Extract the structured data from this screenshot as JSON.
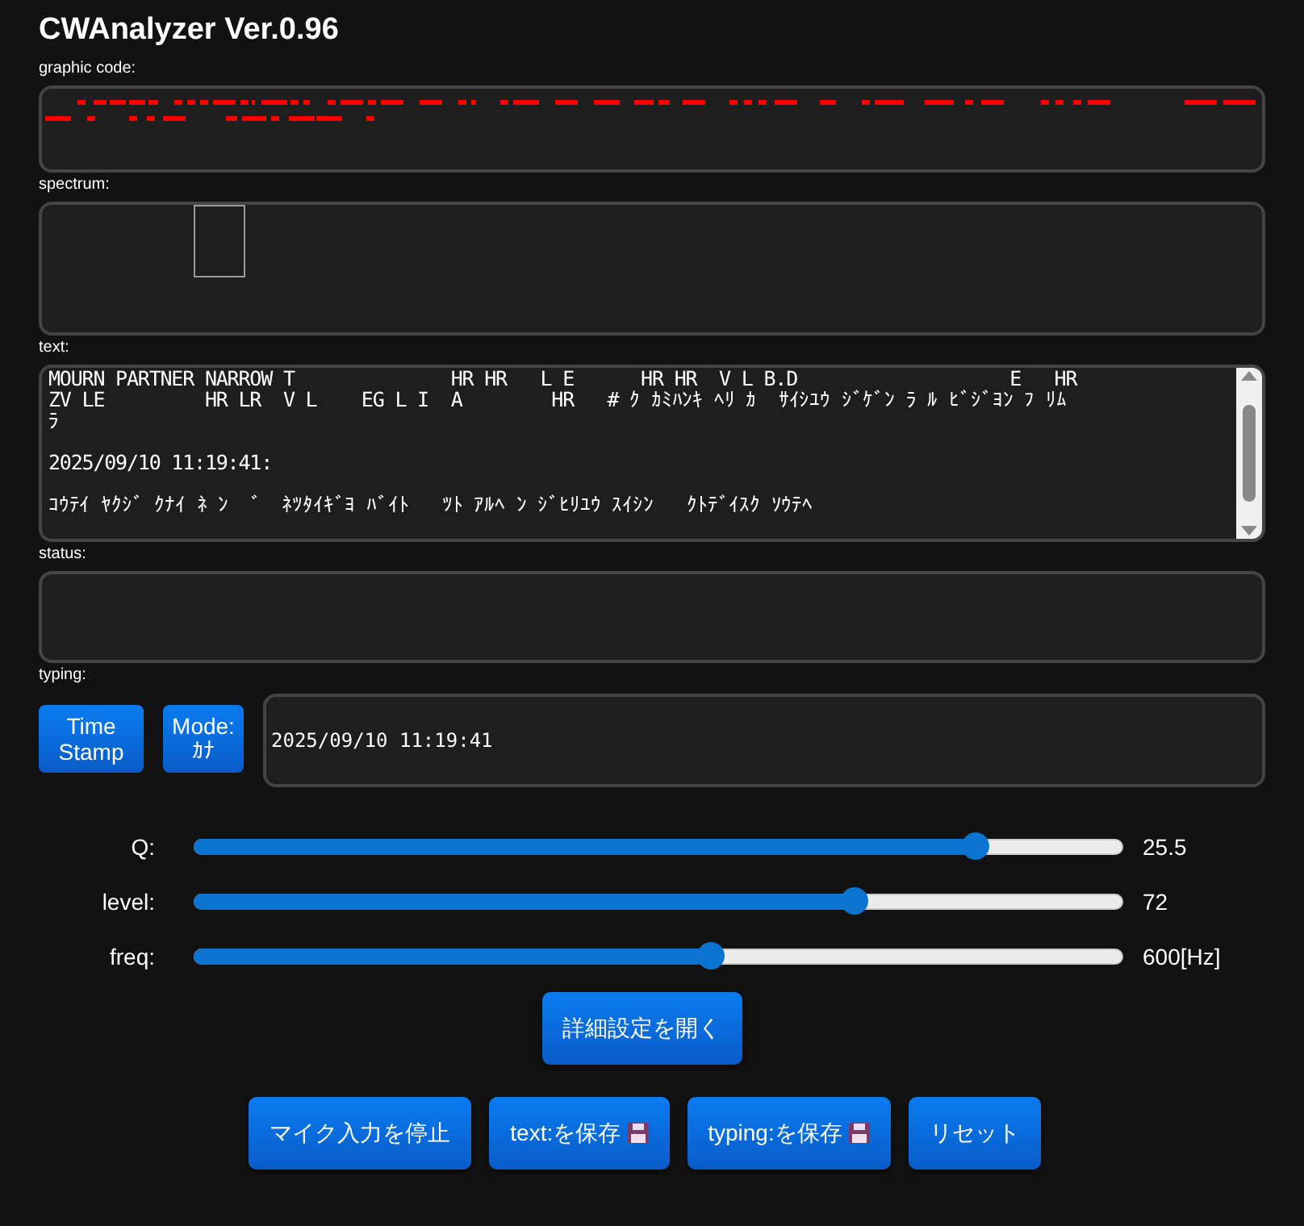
{
  "title": "CWAnalyzer Ver.0.96",
  "graphic_code": {
    "label": "graphic code:"
  },
  "spectrum": {
    "label": "spectrum:"
  },
  "text": {
    "label": "text:",
    "paragraphs": [
      [
        "MOURN PARTNER NARROW T              HR HR   L E      HR HR  V L B.D                   E   HR",
        "ZV LE         HR LR  V L    EG L I  A        HR   # ｸ ｶﾐﾊﾝｷ ﾍﾘ ｶ  ｻｲｼﾕｳ ｼﾞｹﾞﾝ ﾗ ﾙ ﾋﾞｼﾞﾖﾝ ﾌ ﾘﾑ",
        "ﾗ"
      ],
      [
        "2025/09/10 11:19:41:"
      ],
      [
        "ｺｳﾃｲ ﾔｸｼﾞ ｸﾅｲ ﾈ ﾝ  ゛ ﾈﾂﾀｲｷﾞﾖ ﾊﾞｲﾄ   ﾂﾄ ｱﾙﾍ ﾝ ｼﾞﾋﾘﾕｳ ｽｲｼﾝ   ｸﾄﾃﾞｲｽｸ ｿｳﾃﾍ"
      ]
    ]
  },
  "status": {
    "label": "status:"
  },
  "typing": {
    "label": "typing:",
    "timestamp_button": "Time Stamp",
    "mode_button": [
      "Mode:",
      "ｶﾅ"
    ],
    "value": "2025/09/10 11:19:41"
  },
  "sliders": [
    {
      "label": "Q:",
      "level": 0.84,
      "reading": "25.5"
    },
    {
      "label": "level:",
      "level": 0.71,
      "reading": "72"
    },
    {
      "label": "freq:",
      "level": 0.555,
      "reading": "600[Hz]"
    }
  ],
  "settings_button": "詳細設定を開く",
  "buttons": [
    {
      "label": "マイク入力を停止",
      "icon": false
    },
    {
      "label": "text:を保存",
      "icon": true
    },
    {
      "label": "typing:を保存",
      "icon": true
    },
    {
      "label": "リセット",
      "icon": false
    }
  ]
}
